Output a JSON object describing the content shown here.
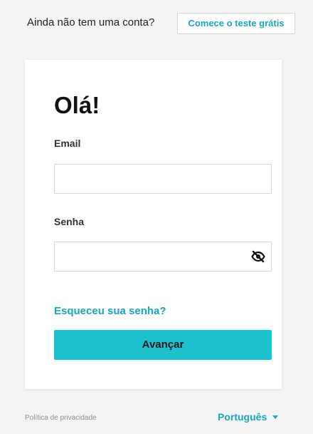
{
  "topbar": {
    "prompt": "Ainda não tem uma conta?",
    "trial_button": "Comece o teste grátis"
  },
  "login": {
    "title": "Olá!",
    "email_label": "Email",
    "email_value": "",
    "password_label": "Senha",
    "password_value": "",
    "forgot_password": "Esqueceu sua senha?",
    "submit": "Avançar"
  },
  "footer": {
    "privacy": "Política de privacidade",
    "language": "Português"
  },
  "icons": {
    "password_toggle": "eye-slash-icon",
    "language_chevron": "chevron-down-icon"
  },
  "colors": {
    "accent": "#1aa7bf",
    "button": "#1ec2cf",
    "background": "#f3f4f5"
  }
}
